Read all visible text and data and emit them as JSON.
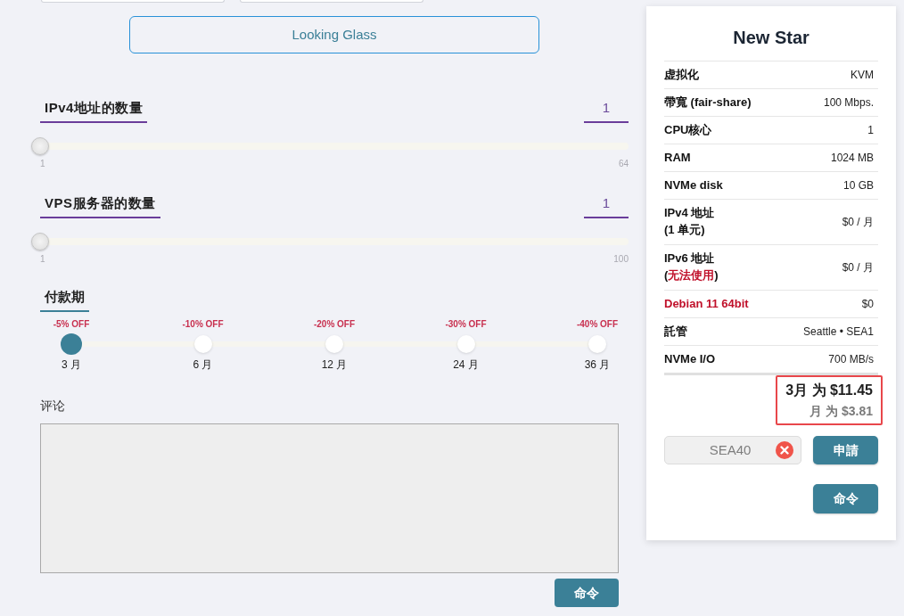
{
  "top_fields": [
    {
      "kind": "input"
    },
    {
      "kind": "input"
    }
  ],
  "looking_glass_button": "Looking Glass",
  "quantity_sliders": [
    {
      "label": "IPv4地址的数量",
      "value": "1",
      "level": 0,
      "min_label": "1",
      "max_label": "64"
    },
    {
      "label": "VPS服务器的数量",
      "value": "1",
      "level": 0,
      "min_label": "1",
      "max_label": "100"
    }
  ],
  "billing_period": {
    "label": "付款期",
    "options": [
      {
        "discount": "-5% OFF",
        "label": "3 月",
        "selected": true
      },
      {
        "discount": "-10% OFF",
        "label": "6 月",
        "selected": false
      },
      {
        "discount": "-20% OFF",
        "label": "12 月",
        "selected": false
      },
      {
        "discount": "-30% OFF",
        "label": "24 月",
        "selected": false
      },
      {
        "discount": "-40% OFF",
        "label": "36 月",
        "selected": false
      }
    ]
  },
  "comment": {
    "label": "评论"
  },
  "order_button": "命令",
  "summary": {
    "title": "New Star",
    "specs": [
      {
        "label": "虚拟化",
        "value": "KVM",
        "alert": false
      },
      {
        "label": "帶寬 (fair-share)",
        "value": "100 Mbps.",
        "alert": false
      },
      {
        "label": "CPU核心",
        "value": "1",
        "alert": false
      },
      {
        "label": "RAM",
        "value": "1024 MB",
        "alert": false
      },
      {
        "label": "NVMe disk",
        "value": "10 GB",
        "alert": false
      },
      {
        "label": "IPv4 地址",
        "note_parts": [
          {
            "text": "(1 单元)",
            "alert": false
          }
        ],
        "value": "$0 / 月",
        "alert": false
      },
      {
        "label": "IPv6 地址",
        "note_parts": [
          {
            "text": "(",
            "alert": false
          },
          {
            "text": "无法使用",
            "alert": true
          },
          {
            "text": ")",
            "alert": false
          }
        ],
        "value": "$0 / 月",
        "alert": false
      },
      {
        "label": "Debian 11 64bit",
        "value": "$0",
        "alert": true
      },
      {
        "label": "託管",
        "value": "Seattle • SEA1",
        "alert": false
      },
      {
        "label": "NVMe I/O",
        "value": "700 MB/s",
        "alert": false
      }
    ],
    "price": {
      "total": "3月 为 $11.45",
      "monthly": "月 为 $3.81",
      "highlighted": true
    },
    "coupon": {
      "value": "SEA40",
      "apply_button": "申請"
    },
    "order_button": "命令"
  }
}
